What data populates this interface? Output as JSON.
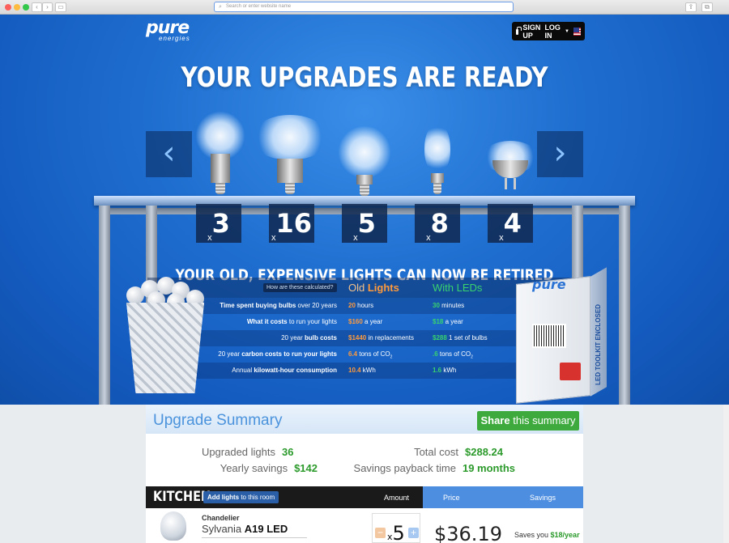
{
  "browser": {
    "address_placeholder": "Search or enter website name"
  },
  "header": {
    "logo_main": "pure",
    "logo_sub": "energies",
    "signup": "SIGN UP",
    "login": "LOG IN"
  },
  "hero": {
    "headline": "YOUR UPGRADES ARE READY",
    "counts": [
      {
        "prefix": "x",
        "value": "3"
      },
      {
        "prefix": "x",
        "value": "16"
      },
      {
        "prefix": "x",
        "value": "5"
      },
      {
        "prefix": "x",
        "value": "8"
      },
      {
        "prefix": "x",
        "value": "4"
      }
    ],
    "retired_heading": "YOUR OLD, EXPENSIVE LIGHTS CAN NOW BE RETIRED",
    "how_calculated": "How are these calculated?",
    "old_label_a": "Old",
    "old_label_b": "Lights",
    "new_label": "With LEDs",
    "rows": [
      {
        "label_bold": "Time spent buying bulbs",
        "label_rest": " over 20 years",
        "old_num": "20",
        "old_unit": " hours",
        "new_num": "30",
        "new_unit": " minutes"
      },
      {
        "label_bold": "What it costs",
        "label_rest": " to run your lights",
        "old_num": "$160",
        "old_unit": " a year",
        "new_num": "$18",
        "new_unit": " a year"
      },
      {
        "label_pre": "20 year ",
        "label_bold": "bulb costs",
        "old_num": "$1440",
        "old_unit": " in replacements",
        "new_num": "$288",
        "new_unit": " 1 set of bulbs"
      },
      {
        "label_pre": "20 year ",
        "label_bold": "carbon costs to run your lights",
        "old_num": "6.4",
        "old_unit": " tons of CO",
        "new_num": ".6",
        "new_unit": " tons of CO"
      },
      {
        "label_pre": "Annual ",
        "label_bold": "kilowatt-hour consumption",
        "old_num": "10.4",
        "old_unit": " kWh",
        "new_num": "1.6",
        "new_unit": " kWh"
      }
    ],
    "box_logo": "pure",
    "box_text": "LED TOOLKIT ENCLOSED"
  },
  "summary": {
    "title": "Upgrade Summary",
    "share_bold": "Share",
    "share_rest": " this summary",
    "upgraded_label": "Upgraded lights",
    "upgraded_value": "36",
    "yearly_label": "Yearly savings",
    "yearly_value": "$142",
    "total_label": "Total cost",
    "total_value": "$288.24",
    "payback_label": "Savings payback time",
    "payback_value": "19 months"
  },
  "kitchen": {
    "title": "KITCHEN",
    "add_bold": "Add lights",
    "add_rest": " to this room",
    "col_amount": "Amount",
    "col_price": "Price",
    "col_savings": "Savings",
    "item_type": "Chandelier",
    "item_brand": "Sylvania ",
    "item_model": "A19 LED",
    "qty_prefix": "x",
    "qty": "5",
    "price": "$36.19",
    "saves_pre": "Saves you ",
    "saves_value": "$18/year"
  }
}
